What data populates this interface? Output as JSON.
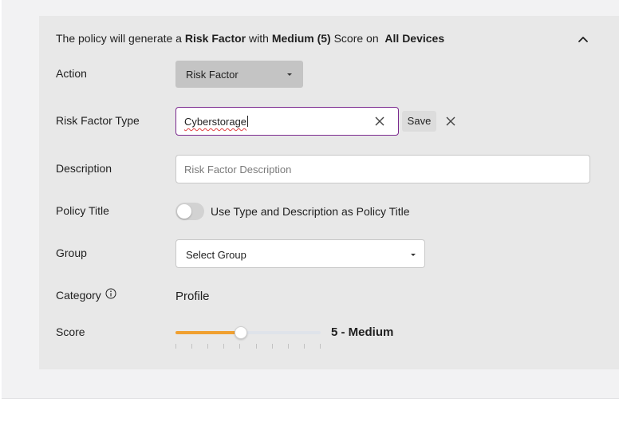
{
  "summary": {
    "prefix": "The policy will generate a",
    "type": "Risk Factor",
    "mid1": "with",
    "score": "Medium (5)",
    "mid2": "Score on",
    "target": "All Devices"
  },
  "fields": {
    "action_label": "Action",
    "action_value": "Risk Factor",
    "risk_factor_type_label": "Risk Factor Type",
    "risk_factor_type_value": "Cyberstorage",
    "save_label": "Save",
    "description_label": "Description",
    "description_placeholder": "Risk Factor Description",
    "policy_title_label": "Policy Title",
    "policy_title_toggle_label": "Use Type and Description as Policy Title",
    "policy_title_toggle_on": false,
    "group_label": "Group",
    "group_value": "Select Group",
    "category_label": "Category",
    "category_value": "Profile",
    "score_label": "Score",
    "score_value": "5 - Medium"
  },
  "score_slider": {
    "min": 1,
    "max": 10,
    "value": 5
  },
  "colors": {
    "accent_focus": "#7b2a8f",
    "slider_fill": "#f0a030",
    "spellcheck": "#e04040"
  },
  "icons": {
    "collapse": "chevron-up-icon",
    "clear": "close-icon",
    "cancel": "close-icon",
    "info": "info-icon",
    "dropdown": "caret-down-icon"
  }
}
